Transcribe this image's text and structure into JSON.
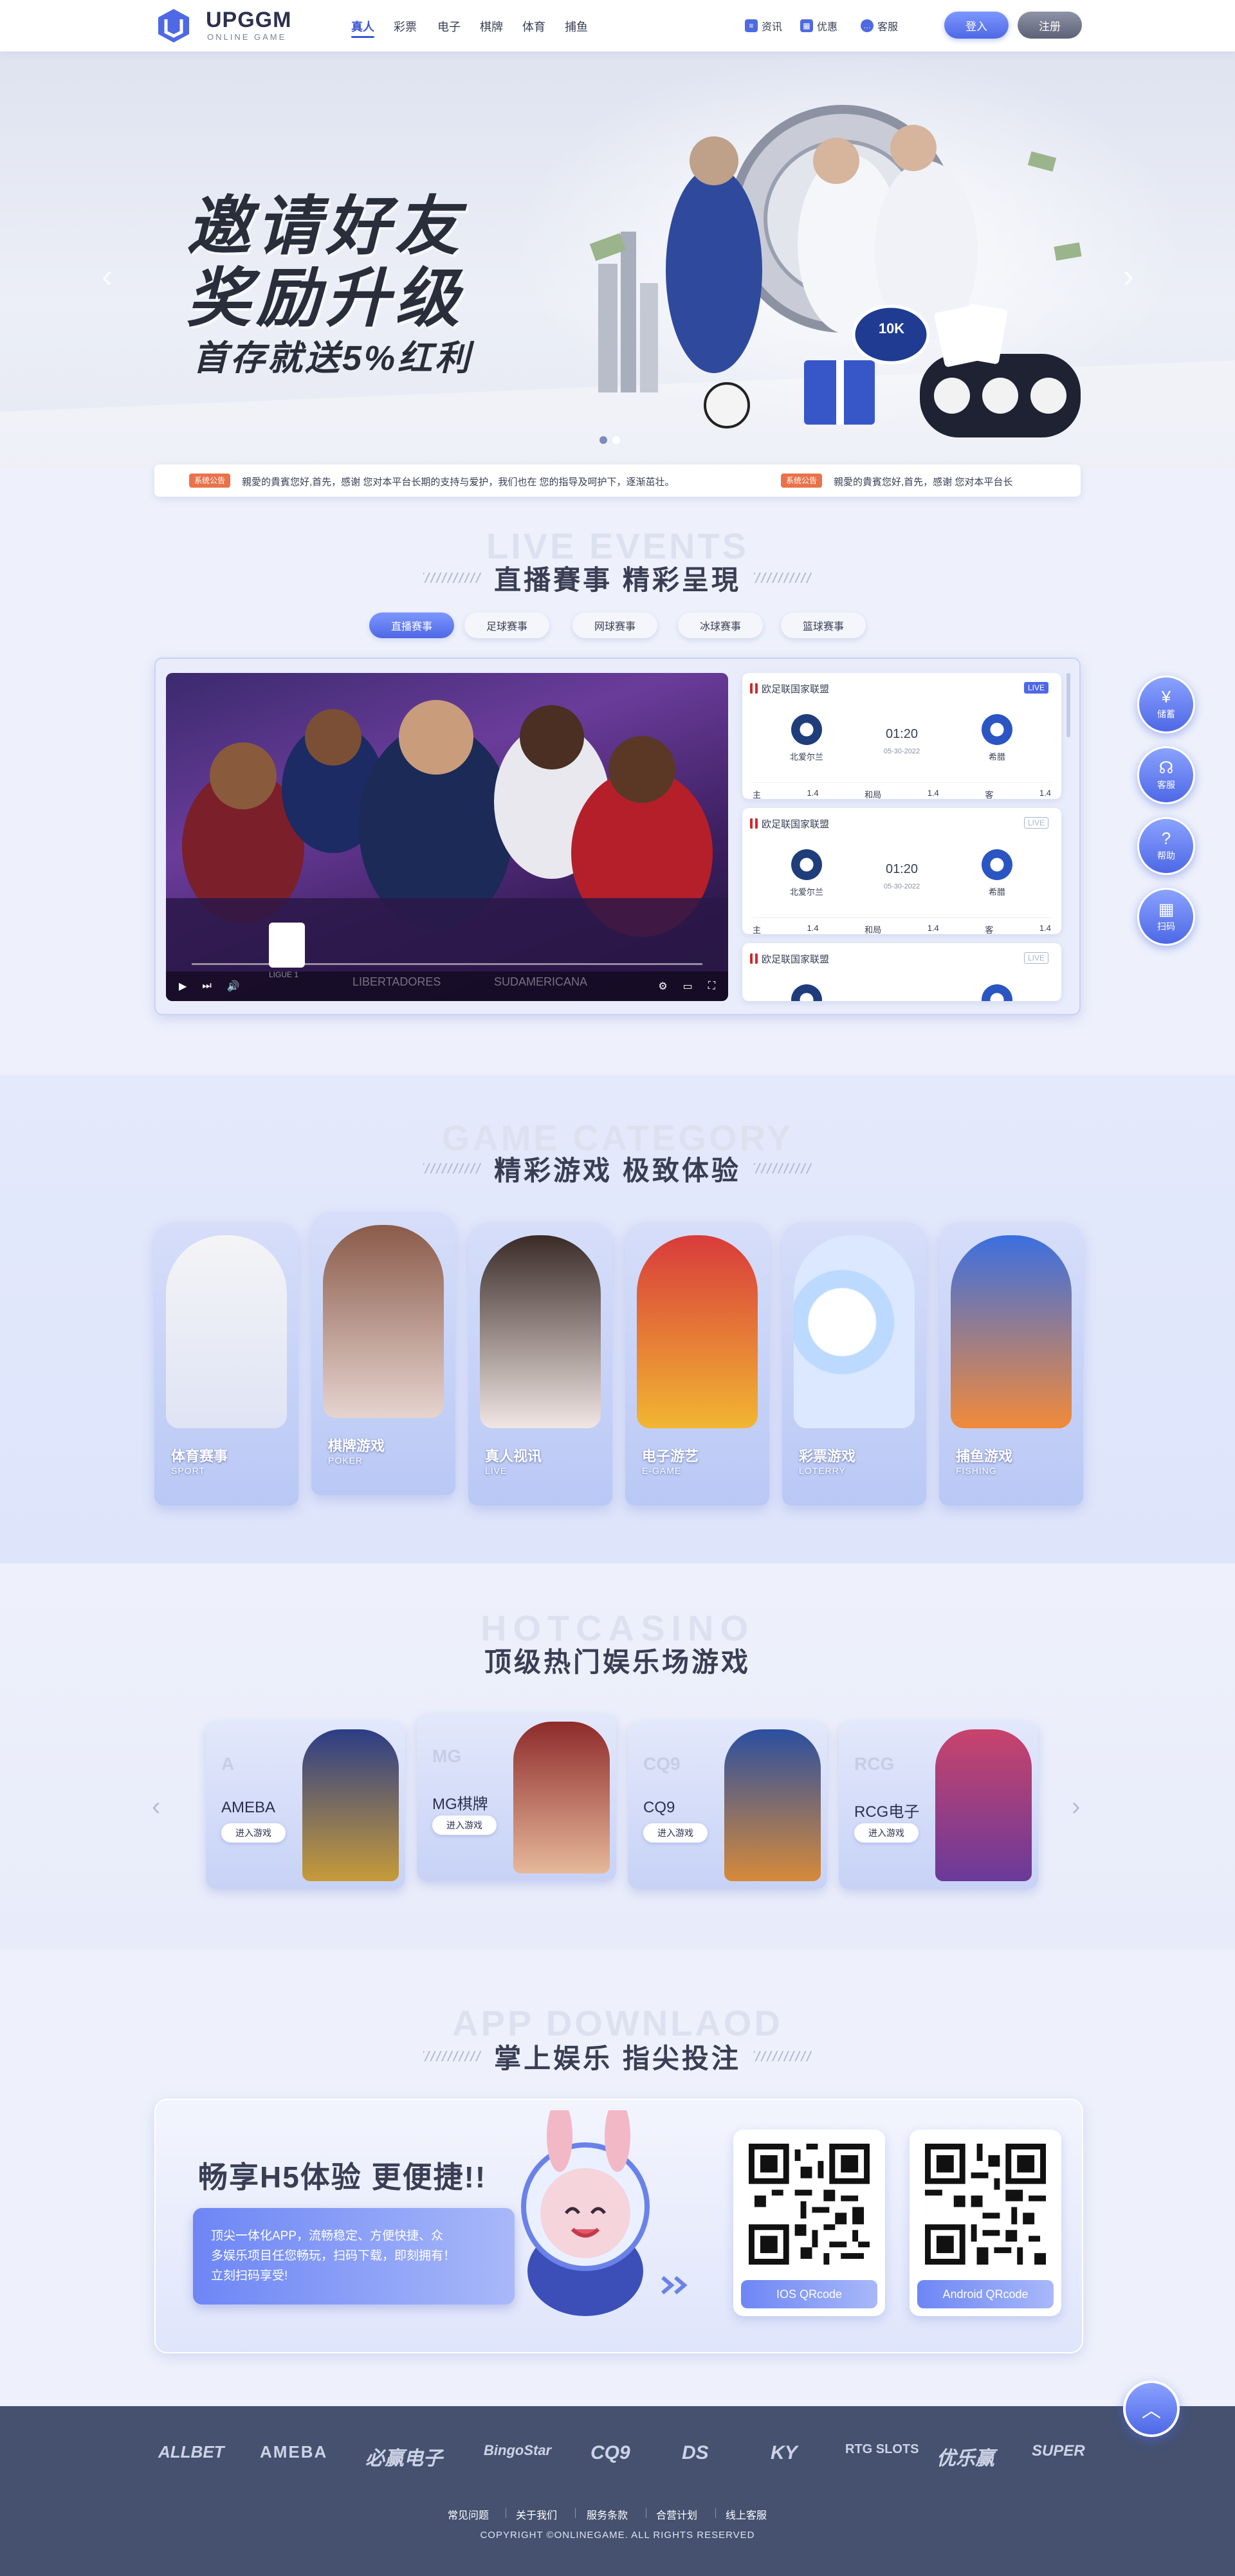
{
  "header": {
    "logo_name": "UPGGM",
    "logo_sub": "ONLINE GAME",
    "nav": [
      "真人",
      "彩票",
      "电子",
      "棋牌",
      "体育",
      "捕鱼"
    ],
    "utils": [
      "资讯",
      "优惠",
      "客服"
    ],
    "login": "登入",
    "register": "注册"
  },
  "hero": {
    "line1": "邀请好友",
    "line2": "奖励升级",
    "line3": "首存就送5%红利",
    "chip_label": "10K"
  },
  "notice": {
    "tag": "系统公告",
    "text": "親愛的貴賓您好,首先，感谢 您对本平台长期的支持与爱护，我们也在 您的指导及呵护下，逐渐茁壮。",
    "text2": "親愛的貴賓您好,首先，感谢 您对本平台长"
  },
  "live": {
    "en": "LIVE EVENTS",
    "cn": "直播賽事 精彩呈現",
    "tabs": [
      "直播赛事",
      "足球赛事",
      "网球赛事",
      "冰球赛事",
      "篮球赛事"
    ],
    "video_logo": "LIGUE 1",
    "video_text1": "LIBERTADORES",
    "video_text2": "SUDAMERICANA",
    "matches": [
      {
        "league": "欧足联国家联盟",
        "live": "LIVE",
        "time": "01:20",
        "date": "05-30-2022",
        "home": "北爱尔兰",
        "away": "希腊",
        "odds": [
          "主",
          "1.4",
          "和局",
          "1.4",
          "客",
          "1.4"
        ]
      },
      {
        "league": "欧足联国家联盟",
        "live": "LIVE",
        "time": "01:20",
        "date": "05-30-2022",
        "home": "北爱尔兰",
        "away": "希腊",
        "odds": [
          "主",
          "1.4",
          "和局",
          "1.4",
          "客",
          "1.4"
        ]
      },
      {
        "league": "欧足联国家联盟",
        "live": "LIVE"
      }
    ]
  },
  "side": [
    "储蓄",
    "客服",
    "帮助",
    "扫码"
  ],
  "category": {
    "en": "GAME CATEGORY",
    "cn": "精彩游戏 极致体验",
    "cards": [
      {
        "cn": "体育赛事",
        "en": "SPORT"
      },
      {
        "cn": "棋牌游戏",
        "en": "POKER"
      },
      {
        "cn": "真人视讯",
        "en": "LIVE"
      },
      {
        "cn": "电子游艺",
        "en": "E-GAME"
      },
      {
        "cn": "彩票游戏",
        "en": "LOTERRY"
      },
      {
        "cn": "捕鱼游戏",
        "en": "FISHING"
      }
    ]
  },
  "hot": {
    "en": "HOTCASINO",
    "cn": "顶级热门娱乐场游戏",
    "cards": [
      {
        "name": "AMEBA",
        "enter": "进入游戏",
        "logo": "A"
      },
      {
        "name": "MG棋牌",
        "enter": "进入游戏",
        "logo": "MG"
      },
      {
        "name": "CQ9",
        "enter": "进入游戏",
        "logo": "CQ9"
      },
      {
        "name": "RCG电子",
        "enter": "进入游戏",
        "logo": "RCG"
      }
    ]
  },
  "app": {
    "en": "APP DOWNLAOD",
    "cn": "掌上娱乐 指尖投注",
    "headline": "畅享H5体验 更便捷!!",
    "desc": "顶尖一体化APP，流畅稳定、方便快捷、众多娱乐项目任您畅玩，扫码下载，即刻拥有！立刻扫码享受!",
    "ios": "IOS QRcode",
    "android": "Android QRcode"
  },
  "footer": {
    "providers": [
      "ALLBET",
      "AMEBA",
      "必赢电子",
      "BingoStar",
      "CQ9",
      "DS",
      "KY",
      "RTG SLOTS",
      "优乐赢",
      "SUPER"
    ],
    "links": [
      "常见问题",
      "关于我们",
      "服务条款",
      "合营计划",
      "线上客服"
    ],
    "copyright": "COPYRIGHT ©ONLINEGAME. ALL RIGHTS RESERVED"
  },
  "colors": {
    "accent": "#4e68e6",
    "footer": "#45516f",
    "notice_tag": "#e8734a"
  }
}
